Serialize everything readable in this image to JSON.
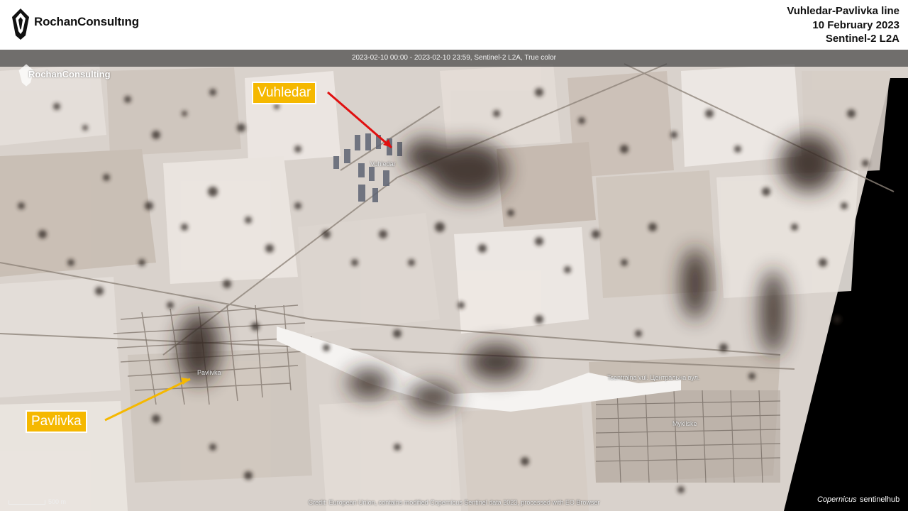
{
  "header": {
    "brand": "RochanConsultıng",
    "title_lines": [
      "Vuhledar-Pavlivka line",
      "10 February 2023",
      "Sentinel-2 L2A"
    ]
  },
  "map": {
    "satellite_caption": "2023-02-10 00:00 - 2023-02-10 23:59, Sentinel-2 L2A, True color",
    "watermark": "RochanConsulting",
    "callouts": {
      "vuhledar": "Vuhledar",
      "pavlivka": "Pavlivka"
    },
    "callout_colors": {
      "vuhledar_arrow": "#e01010",
      "pavlivka_arrow": "#f5b800",
      "box": "#f5b800"
    },
    "place_names": {
      "vuhledar": "Vuhledar",
      "pavlivka": "Pavlivka",
      "mykilske": "Mykilske",
      "tsentralna": "Tsentralna vul. Центральна вул."
    },
    "scale_label": "500 m",
    "credit": "Credit: European Union, contains modified Copernicus Sentinel data 2023, processed with EO Browser",
    "logos": {
      "copernicus": "Copernicus",
      "sentinelhub": "sentinelhub"
    }
  }
}
